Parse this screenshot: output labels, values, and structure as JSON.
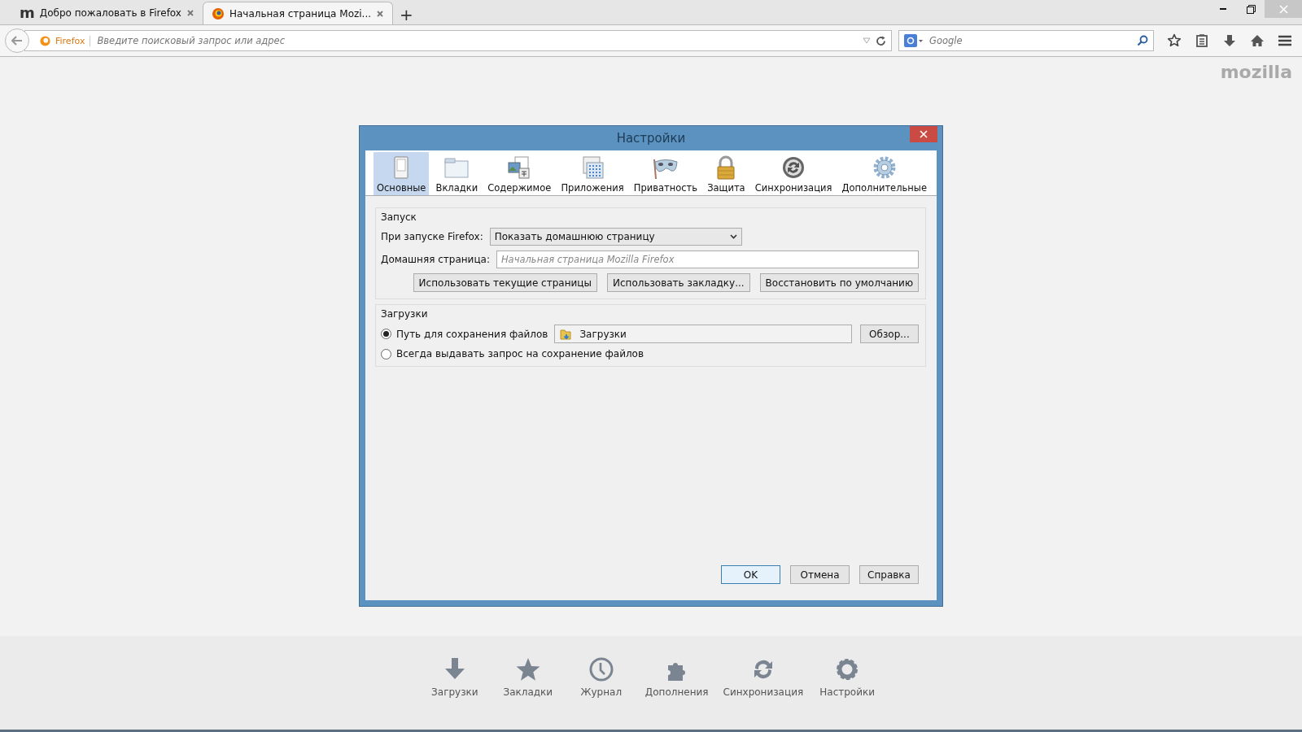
{
  "browser_tabs": [
    {
      "kind": "mozilla",
      "logo": "m",
      "title": "Добро пожаловать в Firefox",
      "selected": false
    },
    {
      "kind": "firefox",
      "title": "Начальная страница Mozi...",
      "selected": true
    }
  ],
  "new_tab": "+",
  "address_bar": {
    "identity": "Firefox",
    "placeholder": "Введите поисковый запрос или адрес"
  },
  "search_bar": {
    "placeholder": "Google"
  },
  "brand": "mozilla",
  "dialog": {
    "title": "Настройки",
    "panes": [
      {
        "kind": "general",
        "label": "Основные",
        "selected": true
      },
      {
        "kind": "tabs",
        "label": "Вкладки",
        "selected": false
      },
      {
        "kind": "content",
        "label": "Содержимое",
        "selected": false
      },
      {
        "kind": "applications",
        "label": "Приложения",
        "selected": false
      },
      {
        "kind": "privacy",
        "label": "Приватность",
        "selected": false
      },
      {
        "kind": "security",
        "label": "Защита",
        "selected": false
      },
      {
        "kind": "sync",
        "label": "Синхронизация",
        "selected": false
      },
      {
        "kind": "advanced",
        "label": "Дополнительные",
        "selected": false
      }
    ],
    "startup": {
      "legend": "Запуск",
      "startup_label": "При запуске Firefox:",
      "startup_value": "Показать домашнюю страницу",
      "homepage_label": "Домашняя страница:",
      "homepage_placeholder": "Начальная страница Mozilla Firefox",
      "buttons": [
        "Использовать текущие страницы",
        "Использовать закладку...",
        "Восстановить по умолчанию"
      ]
    },
    "downloads": {
      "legend": "Загрузки",
      "folder": "Загрузки",
      "browse": "Обзор...",
      "options": [
        {
          "label": "Путь для сохранения файлов",
          "selected": true
        },
        {
          "label": "Всегда выдавать запрос на сохранение файлов",
          "selected": false
        }
      ]
    },
    "footer_buttons": [
      {
        "label": "OK",
        "default": true
      },
      {
        "label": "Отмена",
        "default": false
      },
      {
        "label": "Справка",
        "default": false
      }
    ]
  },
  "launcher": [
    {
      "kind": "download",
      "label": "Загрузки"
    },
    {
      "kind": "bookmark",
      "label": "Закладки"
    },
    {
      "kind": "history",
      "label": "Журнал"
    },
    {
      "kind": "addons",
      "label": "Дополнения"
    },
    {
      "kind": "sync",
      "label": "Синхронизация"
    },
    {
      "kind": "settings",
      "label": "Настройки"
    }
  ]
}
